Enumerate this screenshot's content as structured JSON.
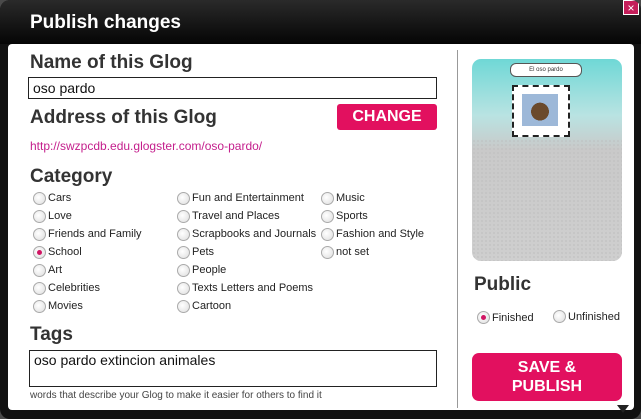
{
  "dialog": {
    "title": "Publish changes",
    "close_glyph": "×"
  },
  "name_section": {
    "heading": "Name of this Glog",
    "value": "oso pardo"
  },
  "address_section": {
    "heading": "Address of this Glog",
    "change_label": "CHANGE",
    "url": "http://swzpcdb.edu.glogster.com/oso-pardo/"
  },
  "category": {
    "heading": "Category",
    "selected": "School",
    "col1": [
      "Cars",
      "Love",
      "Friends and Family",
      "School",
      "Art",
      "Celebrities",
      "Movies"
    ],
    "col2": [
      "Fun and Entertainment",
      "Travel and Places",
      "Scrapbooks and Journals",
      "Pets",
      "People",
      "Texts Letters and Poems",
      "Cartoon"
    ],
    "col3": [
      "Music",
      "Sports",
      "Fashion and Style",
      "not set"
    ]
  },
  "tags": {
    "heading": "Tags",
    "value": "oso pardo extincion animales",
    "hint": "words that describe your Glog to make it easier for others to find it"
  },
  "preview": {
    "caption": "El oso pardo"
  },
  "public_section": {
    "heading": "Public",
    "options": [
      "Finished",
      "Unfinished"
    ],
    "selected": "Finished"
  },
  "save_button": {
    "line1": "SAVE &",
    "line2": "PUBLISH"
  },
  "colors": {
    "accent": "#e2105f",
    "titlebar": "#111111",
    "link": "#c41e8c"
  }
}
